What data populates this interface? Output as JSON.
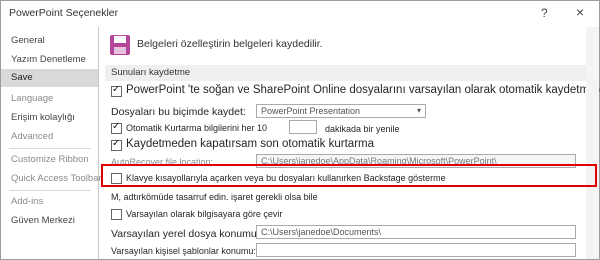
{
  "window": {
    "title": "PowerPoint Seçenekler",
    "help_icon": "?",
    "close_icon": "×"
  },
  "sidebar": {
    "items": [
      {
        "label": "General"
      },
      {
        "label": "Yazım Denetleme"
      },
      {
        "label": "Save"
      },
      {
        "label": "Language"
      },
      {
        "label": "Erişim kolaylığı"
      },
      {
        "label": "Advanced"
      },
      {
        "label": "Customize Ribbon"
      },
      {
        "label": "Quick Access Toolbar"
      },
      {
        "label": "Add-ins"
      },
      {
        "label": "Güven Merkezi"
      }
    ],
    "selected": "Save"
  },
  "main": {
    "header": "Belgeleri özelleştirin belgeleri kaydedilir.",
    "section": "Sunuları kaydetme",
    "opt_onedrive": "PowerPoint 'te soğan ve SharePoint Online dosyalarını varsayılan olarak otomatik kaydetme @",
    "format_label": "Dosyaları bu biçimde kaydet:",
    "format_value": "PowerPoint Presentation",
    "autorecover_label": "Otomatik Kurtarma bilgilerini her 10",
    "autorecover_value": "",
    "minutes_label": "dakikada bir yenile",
    "keep_last_label": "Kaydetmeden kapatırsam son otomatik kurtarma",
    "ar_location_label": "AutoRecover file location:",
    "ar_location_value": "C:\\Users\\janedoe\\AppData\\Roaming\\Microsoft\\PowerPoint\\",
    "backstage_label": "Klavye kısayollarıyla açarken veya bu dosyaları kullanırken Backstage gösterme",
    "signin_note": "M, adtırkömüde tasarruf edin. işaret gerekli olsa bile",
    "default_computer_label": "Varsayılan olarak bilgisayara göre çevir",
    "default_local_label": "Varsayılan yerel dosya konumu:",
    "default_local_value": "C:\\Users\\janedoe\\Documents\\",
    "personal_templates_label": "Varsayılan kişisel şablonlar konumu:",
    "personal_templates_value": ""
  },
  "colors": {
    "highlight": "#e00000",
    "selected_nav": "#d9d9d9",
    "save_icon": "#b4469a"
  }
}
